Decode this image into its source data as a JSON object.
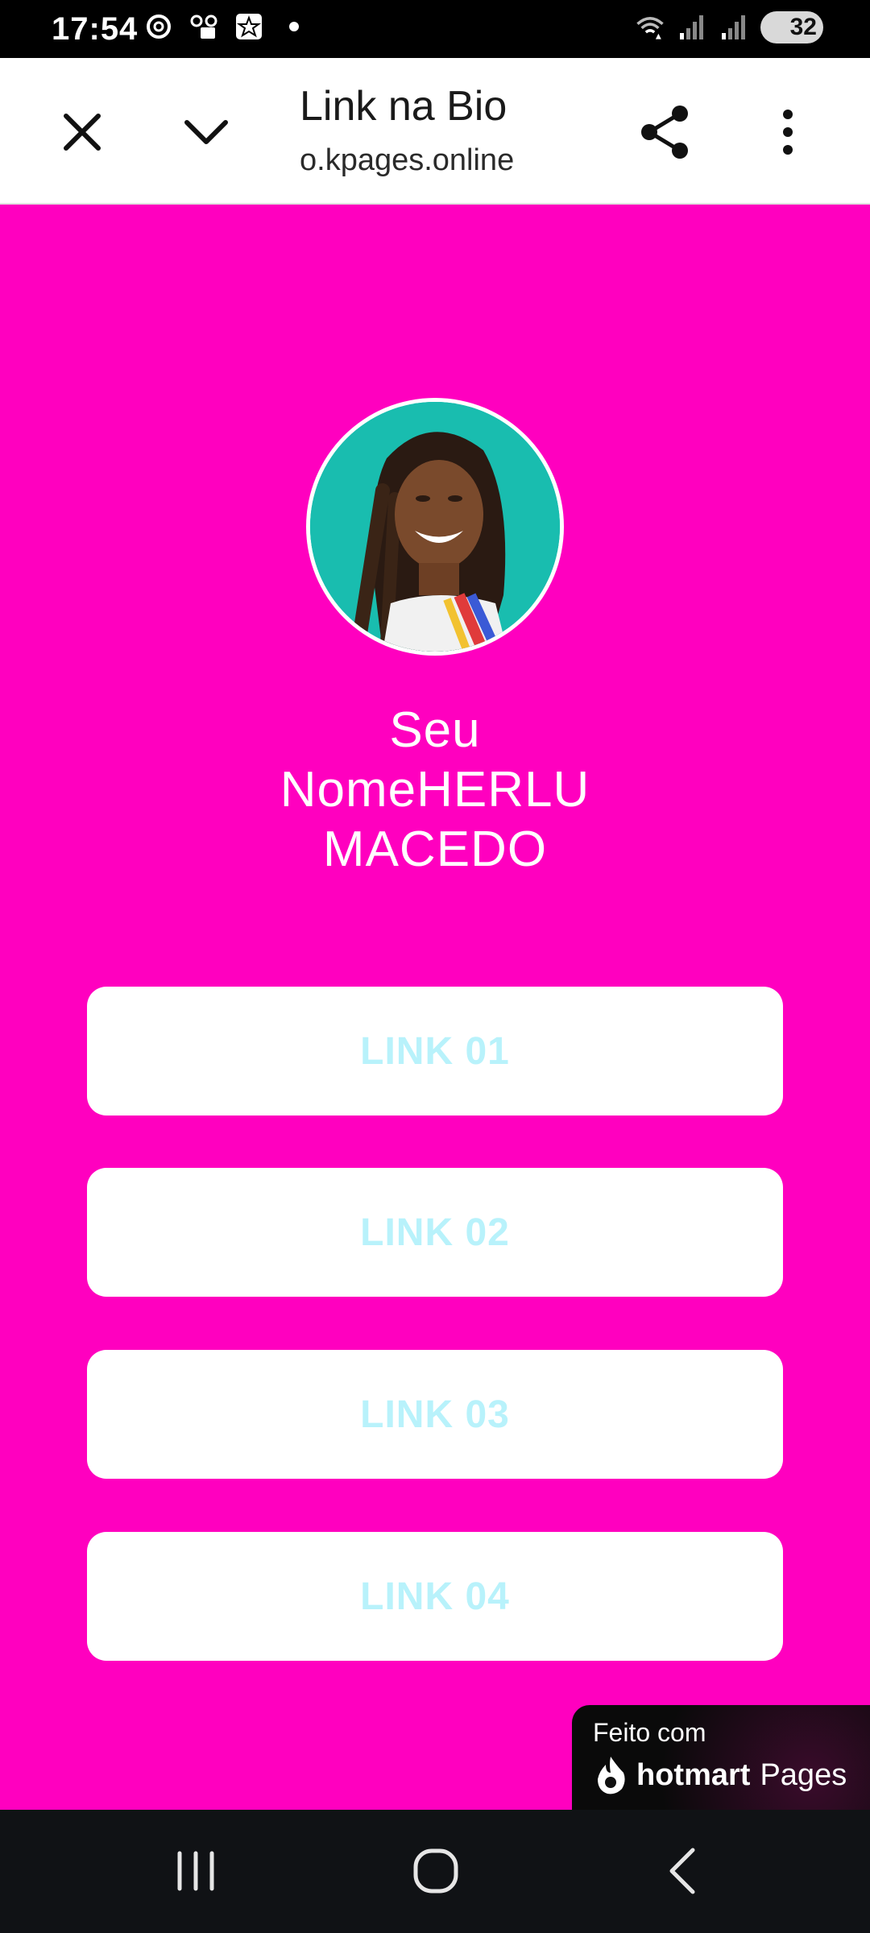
{
  "status_bar": {
    "time": "17:54",
    "battery": "32",
    "icons": [
      "threads-icon",
      "voicemail-icon",
      "lock-icon",
      "star-icon",
      "dot-icon",
      "wifi-icon",
      "signal-icon",
      "signal-icon-2",
      "battery-icon"
    ]
  },
  "toolbar": {
    "title": "Link na Bio",
    "url": "o.kpages.online",
    "icons": [
      "close-icon",
      "chevron-down-icon",
      "share-icon",
      "more-vert-icon"
    ]
  },
  "profile": {
    "name_line1": "Seu",
    "name_line2": "NomeHERLU",
    "name_line3": "MACEDO"
  },
  "links": [
    {
      "label": "LINK 01"
    },
    {
      "label": "LINK 02"
    },
    {
      "label": "LINK 03"
    },
    {
      "label": "LINK 04"
    }
  ],
  "badge": {
    "line1": "Feito com",
    "brand": "hotmart",
    "product": "Pages"
  },
  "nav": {
    "icons": [
      "recent-apps-icon",
      "home-icon",
      "back-icon"
    ]
  },
  "colors": {
    "page_background": "#ff00bf",
    "button_text": "#b8f2fb",
    "button_background": "#ffffff"
  }
}
